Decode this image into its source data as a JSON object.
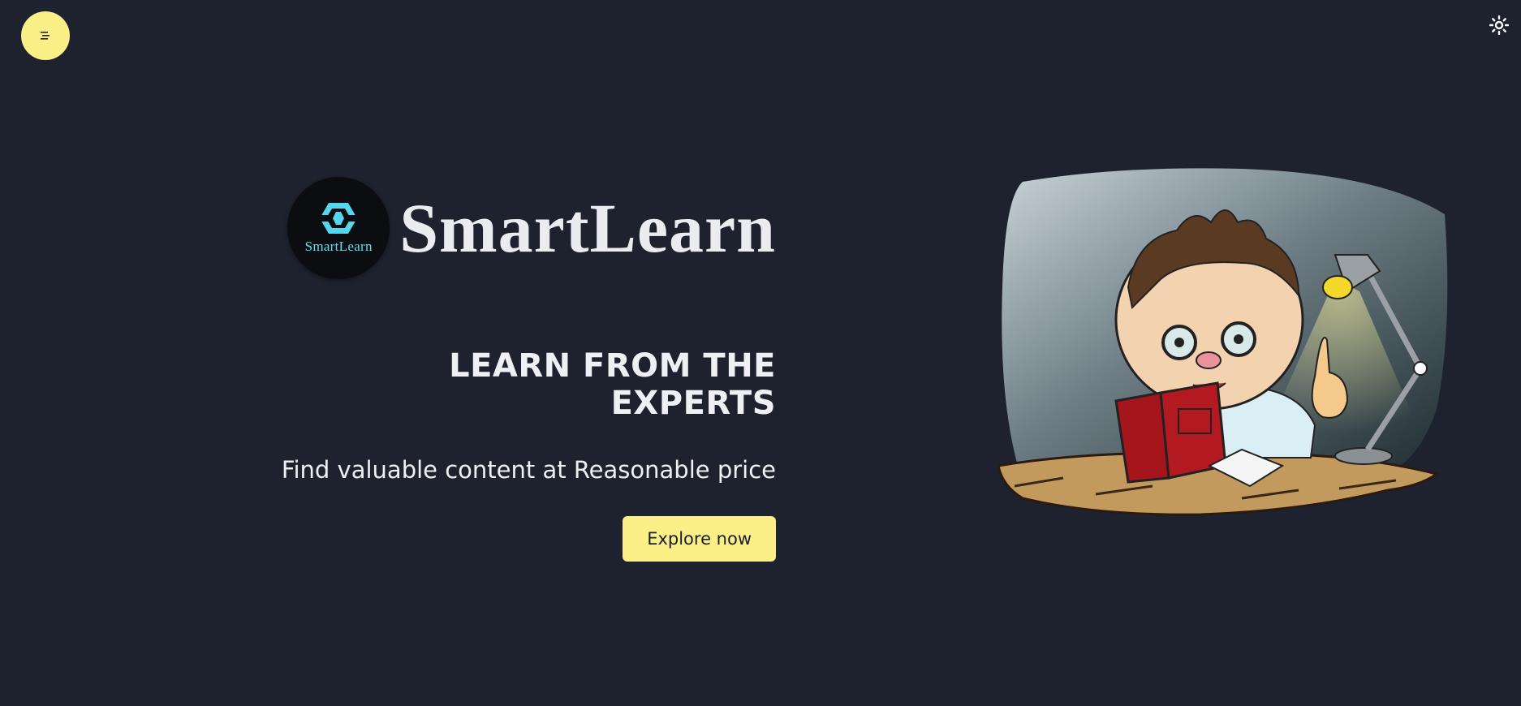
{
  "header": {
    "menu_icon": "hamburger-menu-icon",
    "theme_icon": "sun-icon"
  },
  "brand": {
    "logo_text": "SmartLearn",
    "name": "SmartLearn"
  },
  "hero": {
    "headline": "LEARN FROM THE EXPERTS",
    "subline": "Find valuable content at Reasonable price",
    "cta_label": "Explore now"
  },
  "colors": {
    "background": "#1d222e",
    "accent": "#fbef88",
    "logo_teal": "#5ee2f0"
  }
}
